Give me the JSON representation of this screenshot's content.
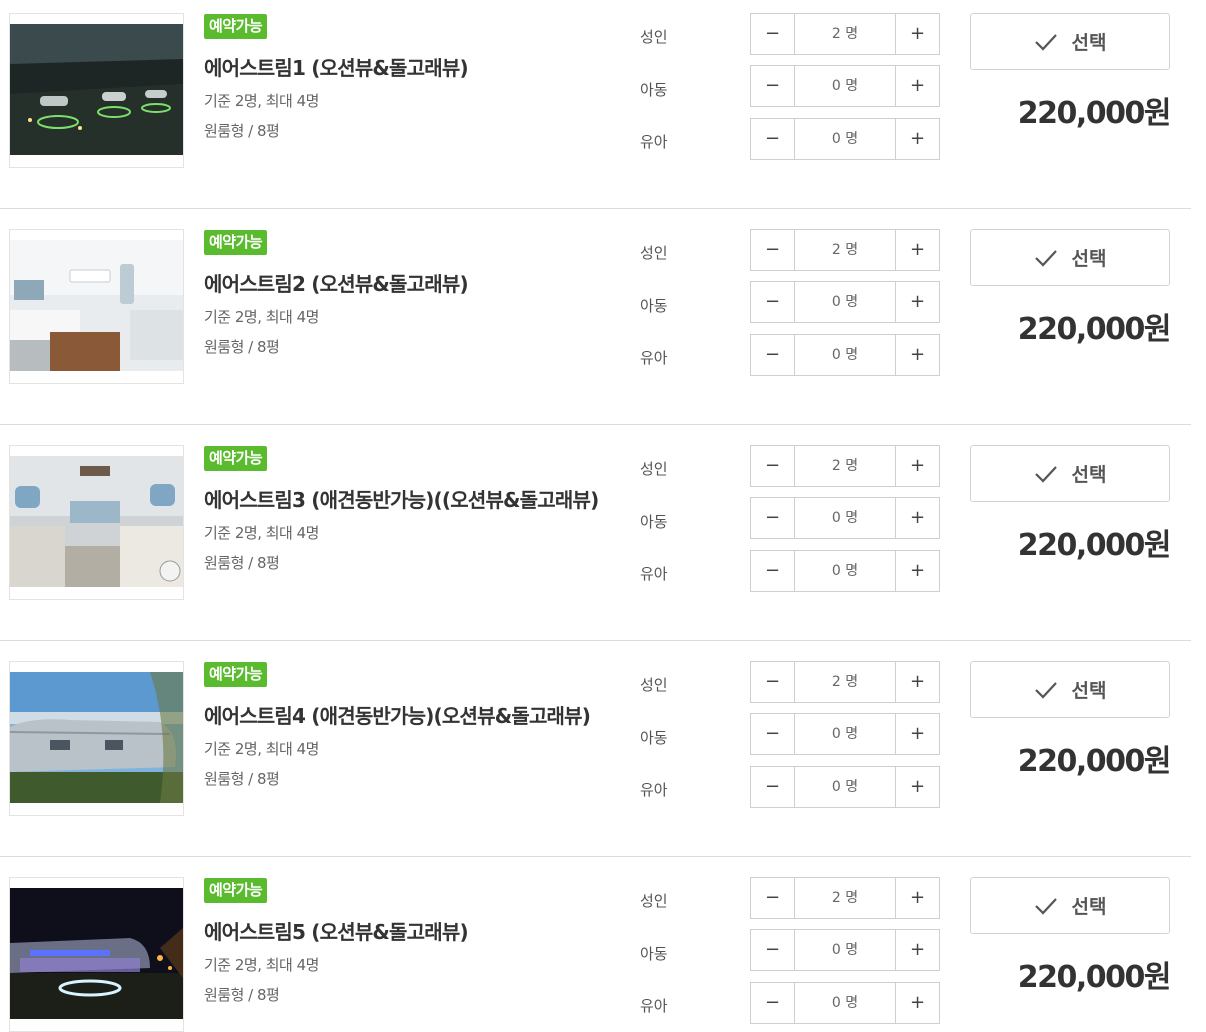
{
  "rooms": [
    {
      "badge": "예약가능",
      "name": "에어스트림1 (오션뷰&돌고래뷰)",
      "capacity": "기준 2명, 최대 4명",
      "size": "원룸형 / 8평",
      "guests": [
        {
          "label": "성인",
          "value": "2 명"
        },
        {
          "label": "아동",
          "value": "0 명"
        },
        {
          "label": "유아",
          "value": "0 명"
        }
      ],
      "select_label": "선택",
      "price": "220,000원"
    },
    {
      "badge": "예약가능",
      "name": "에어스트림2 (오션뷰&돌고래뷰)",
      "capacity": "기준 2명, 최대 4명",
      "size": "원룸형 / 8평",
      "guests": [
        {
          "label": "성인",
          "value": "2 명"
        },
        {
          "label": "아동",
          "value": "0 명"
        },
        {
          "label": "유아",
          "value": "0 명"
        }
      ],
      "select_label": "선택",
      "price": "220,000원"
    },
    {
      "badge": "예약가능",
      "name": "에어스트림3 (애견동반가능)((오션뷰&돌고래뷰)",
      "capacity": "기준 2명, 최대 4명",
      "size": "원룸형 / 8평",
      "guests": [
        {
          "label": "성인",
          "value": "2 명"
        },
        {
          "label": "아동",
          "value": "0 명"
        },
        {
          "label": "유아",
          "value": "0 명"
        }
      ],
      "select_label": "선택",
      "price": "220,000원"
    },
    {
      "badge": "예약가능",
      "name": "에어스트림4 (애견동반가능)(오션뷰&돌고래뷰)",
      "capacity": "기준 2명, 최대 4명",
      "size": "원룸형 / 8평",
      "guests": [
        {
          "label": "성인",
          "value": "2 명"
        },
        {
          "label": "아동",
          "value": "0 명"
        },
        {
          "label": "유아",
          "value": "0 명"
        }
      ],
      "select_label": "선택",
      "price": "220,000원"
    },
    {
      "badge": "예약가능",
      "name": "에어스트림5 (오션뷰&돌고래뷰)",
      "capacity": "기준 2명, 최대 4명",
      "size": "원룸형 / 8평",
      "guests": [
        {
          "label": "성인",
          "value": "2 명"
        },
        {
          "label": "아동",
          "value": "0 명"
        },
        {
          "label": "유아",
          "value": "0 명"
        }
      ],
      "select_label": "선택",
      "price": "220,000원"
    }
  ],
  "stepper_symbols": {
    "minus": "−",
    "plus": "+"
  },
  "icons": {
    "select": "check-icon"
  },
  "colors": {
    "badge": "#5bbb2e",
    "price": "#333333",
    "border": "#cfcfcf"
  }
}
